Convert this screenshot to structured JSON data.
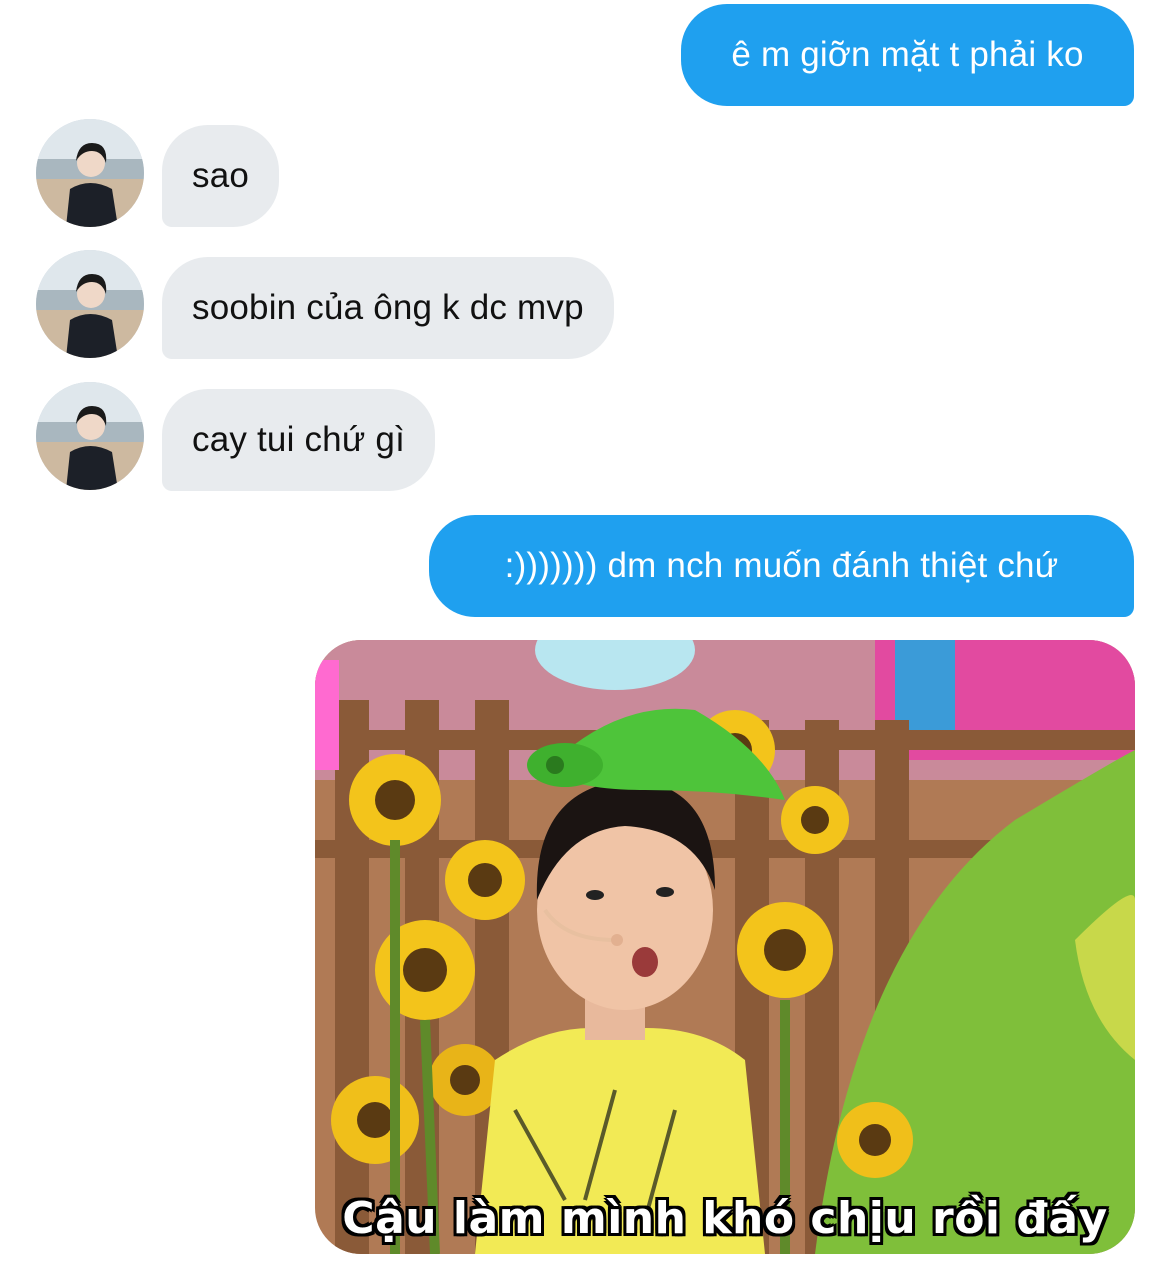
{
  "colors": {
    "outgoing_bubble": "#1fa0ef",
    "incoming_bubble": "#e8ebee",
    "background": "#ffffff"
  },
  "messages": [
    {
      "direction": "outgoing",
      "text": "ê m giỡn mặt t phải ko"
    },
    {
      "direction": "incoming",
      "text": "sao",
      "avatar": "sender-avatar"
    },
    {
      "direction": "incoming",
      "text": "soobin của ông k dc mvp",
      "avatar": "sender-avatar"
    },
    {
      "direction": "incoming",
      "text": "cay tui chứ gì",
      "avatar": "sender-avatar"
    },
    {
      "direction": "outgoing",
      "text": ":))))))) dm nch muốn đánh thiệt chứ"
    },
    {
      "direction": "outgoing",
      "type": "image",
      "image_caption": "Cậu làm mình khó chịu rồi đấy"
    }
  ]
}
